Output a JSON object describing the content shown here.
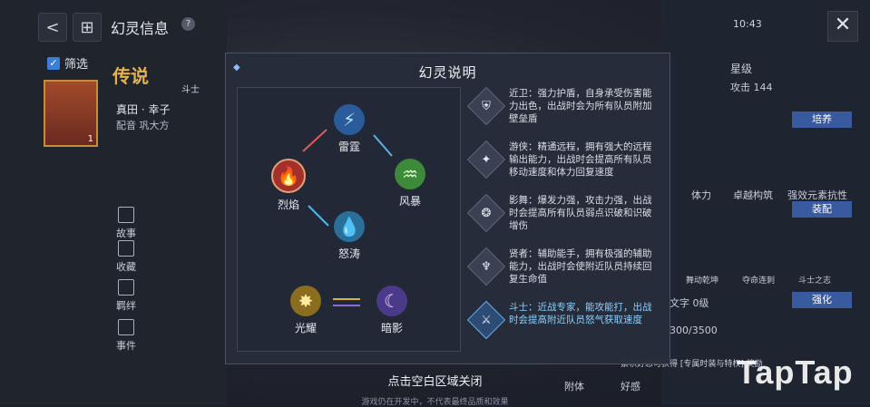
{
  "header": {
    "title": "幻灵信息",
    "help": "?",
    "time": "10:43",
    "close": "✕",
    "back": "<",
    "grid": "⊞"
  },
  "filter": {
    "label": "筛选",
    "check": "✓"
  },
  "card": {
    "count": "1"
  },
  "character": {
    "rank": "传说",
    "role": "斗士",
    "name": "真田 · 幸子",
    "voice": "配音  巩大方"
  },
  "side_nav": [
    "故事",
    "收藏",
    "羁绊",
    "事件"
  ],
  "right_panel": {
    "star_label": "星级",
    "attack": "攻击 144",
    "cultivate": "培养",
    "stats": [
      "体力",
      "卓越构筑",
      "强效元素抗性"
    ],
    "equip": "装配",
    "skills": [
      "舞动乾坤",
      "夺命连刺",
      "斗士之志"
    ],
    "strengthen": "强化",
    "text_level": "文字 0级",
    "progress": "300/3500",
    "note": "累积好感可获得 [专属时装与特权] 奖励",
    "attach": "附体",
    "favor": "好感"
  },
  "modal": {
    "title": "幻灵说明",
    "elements": {
      "thunder": "雷霆",
      "storm": "风暴",
      "wave": "怒涛",
      "flame": "烈焰",
      "light": "光耀",
      "shadow": "暗影"
    },
    "roles": [
      {
        "icon": "guard-icon",
        "text": "近卫：强力护盾，自身承受伤害能力出色，出战时会为所有队员附加壁垒盾"
      },
      {
        "icon": "ranger-icon",
        "text": "游侠：精通远程，拥有强大的远程输出能力，出战时会提高所有队员移动速度和体力回复速度"
      },
      {
        "icon": "shadow-role-icon",
        "text": "影舞：爆发力强，攻击力强，出战时会提高所有队员弱点识破和识破增伤"
      },
      {
        "icon": "sage-icon",
        "text": "贤者：辅助能手，拥有极强的辅助能力，出战时会使附近队员持续回复生命值"
      },
      {
        "icon": "fighter-icon",
        "text": "斗士：近战专家，能攻能打，出战时会提高附近队员怒气获取速度"
      }
    ]
  },
  "close_hint": "点击空白区域关闭",
  "footnote": "游戏仍在开发中，不代表最终品质和效果",
  "watermark": "TapTap",
  "colors": {
    "accent": "#3a5aa0",
    "highlight": "#8fd0ff"
  }
}
